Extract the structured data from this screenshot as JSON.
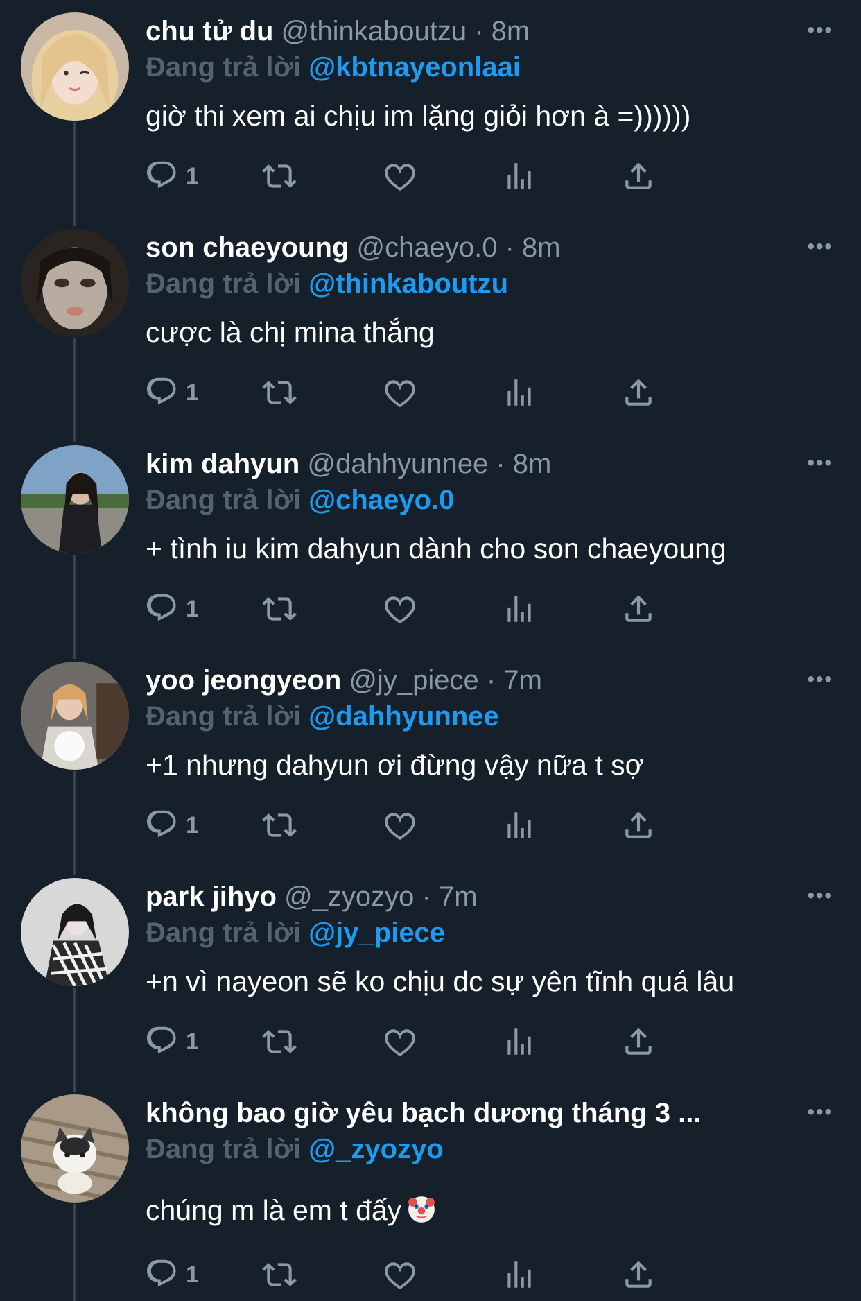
{
  "tweets": [
    {
      "name": "chu tử du",
      "handle": "@thinkaboutzu",
      "dot": "·",
      "time": "8m",
      "reply_prefix": "Đang trả lời",
      "reply_to": "@kbtnayeonlaai",
      "text": "giờ thi xem ai chịu im lặng giỏi hơn à =))))))",
      "reply_count": "1"
    },
    {
      "name": "son chaeyoung",
      "handle": "@chaeyo.0",
      "dot": "·",
      "time": "8m",
      "reply_prefix": "Đang trả lời",
      "reply_to": "@thinkaboutzu",
      "text": "cược là chị mina thắng",
      "reply_count": "1"
    },
    {
      "name": "kim dahyun",
      "handle": "@dahhyunnee",
      "dot": "·",
      "time": "8m",
      "reply_prefix": "Đang trả lời",
      "reply_to": "@chaeyo.0",
      "text": "+ tình iu kim dahyun dành cho son chaeyoung",
      "reply_count": "1"
    },
    {
      "name": "yoo jeongyeon",
      "handle": "@jy_piece",
      "dot": "·",
      "time": "7m",
      "reply_prefix": "Đang trả lời",
      "reply_to": "@dahhyunnee",
      "text": "+1 nhưng dahyun ơi đừng vậy nữa t sợ",
      "reply_count": "1"
    },
    {
      "name": "park jihyo",
      "handle": "@_zyozyo",
      "dot": "·",
      "time": "7m",
      "reply_prefix": "Đang trả lời",
      "reply_to": "@jy_piece",
      "text": "+n vì nayeon sẽ ko chịu dc sự yên tĩnh quá lâu",
      "reply_count": "1"
    },
    {
      "name": "không bao giờ yêu bạch dương tháng 3 ...",
      "handle": "",
      "dot": "",
      "time": "",
      "reply_prefix": "Đang trả lời",
      "reply_to": "@_zyozyo",
      "text": "chúng m là em t đấy",
      "emoji": "clown-face-emoji",
      "reply_count": "1"
    }
  ],
  "more_label": "•••",
  "icons": [
    "reply-icon",
    "retweet-icon",
    "like-icon",
    "views-icon",
    "share-icon"
  ],
  "colors": {
    "background": "#15202b",
    "accent": "#1d9bf0",
    "muted": "#8b98a5",
    "thread_line": "#38444d"
  }
}
